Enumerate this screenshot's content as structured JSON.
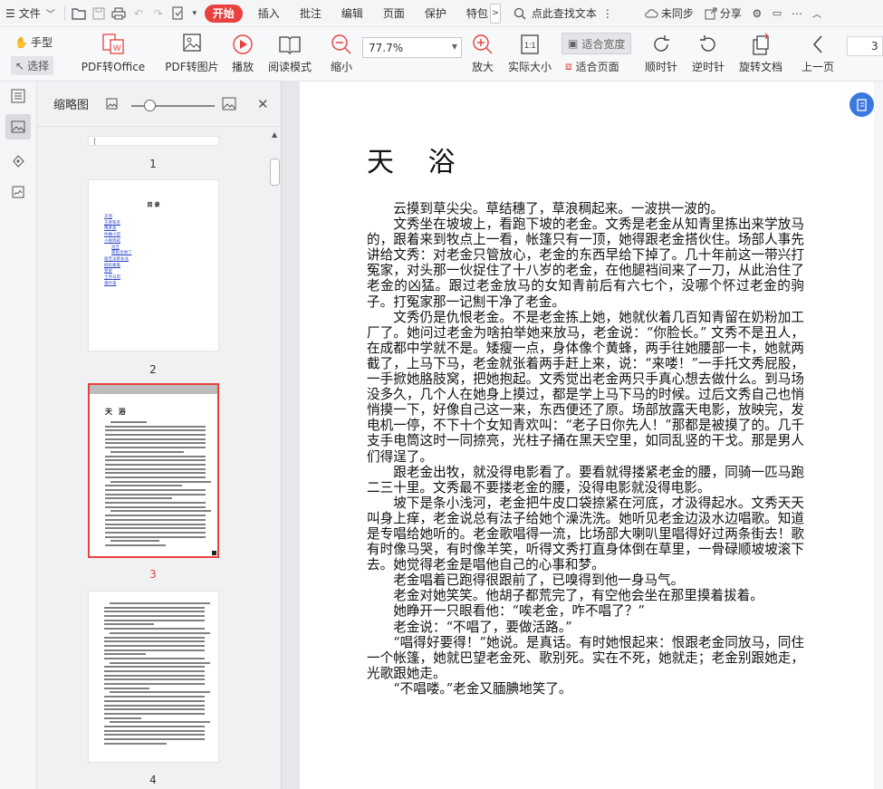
{
  "menubar": {
    "file_label": "文件",
    "tabs": [
      "开始",
      "插入",
      "批注",
      "编辑",
      "页面",
      "保护",
      "特包"
    ],
    "active_tab": "开始",
    "search_label": "点此查找文本",
    "sync_label": "未同步",
    "share_label": "分享"
  },
  "toolbar": {
    "hand_label": "手型",
    "select_label": "选择",
    "pdf_office_label": "PDF转Office",
    "pdf_image_label": "PDF转图片",
    "play_label": "播放",
    "read_mode_label": "阅读模式",
    "zoom_out_label": "缩小",
    "zoom_value": "77.7%",
    "zoom_in_label": "放大",
    "actual_size_label": "实际大小",
    "fit_width_label": "适合宽度",
    "fit_page_label": "适合页面",
    "rotate_cw_label": "顺时针",
    "rotate_ccw_label": "逆时针",
    "rotate_doc_label": "旋转文档",
    "prev_page_label": "上一页",
    "page_input": "3"
  },
  "thumbnail_panel": {
    "title": "缩略图",
    "pages": [
      {
        "num": "1"
      },
      {
        "num": "2",
        "heading": "目 录"
      },
      {
        "num": "3",
        "heading": "天 浴"
      },
      {
        "num": "4"
      }
    ],
    "selected_page": "3",
    "toc_lines": [
      "天浴",
      "王者和贪",
      "两茅盖",
      "你做小瓷",
      "小瓶戏班",
      "追旦",
      "孤鱼灵谢了",
      "极无法欲长龙",
      "奴妈素着",
      "星泉",
      "士月与剪",
      "落叶夜"
    ]
  },
  "document": {
    "title": "天  浴",
    "paragraphs": [
      "云摸到草尖尖。草结穗了，草浪稠起来。一波拱一波的。",
      "文秀坐在坡坡上，看跑下坡的老金。文秀是老金从知青里拣出来学放马的，跟着来到牧点上一看，帐篷只有一顶，她得跟老金搭伙住。场部人事先讲给文秀：对老金只管放心，老金的东西早给下掉了。几十年前这一带兴打冤家，对头那一伙捉住了十八岁的老金，在他腿裆间来了一刀，从此治住了老金的凶猛。跟过老金放马的女知青前后有六七个，没哪个怀过老金的驹子。打冤家那一记劁干净了老金。",
      "文秀仍是仇恨老金。不是老金拣上她，她就伙着几百知青留在奶粉加工厂了。她问过老金为啥拍举她来放马，老金说：“你脸长。” 文秀不是丑人，在成都中学就不是。矮瘦一点，身体像个黄蜂，两手往她腰部一卡，她就两截了，上马下马，老金就张着两手赶上来，说：“来喽！”一手托文秀屁股，一手掀她胳肢窝，把她抱起。文秀觉出老金两只手真心想去做什么。到马场没多久，几个人在她身上摸过，都是学上马下马的时候。过后文秀自己也悄悄摸一下，好像自己这一来，东西便还了原。场部放露天电影，放映完，发电机一停，不下十个女知青欢叫：“老子日你先人！”那都是被摸了的。几千支手电筒这时一同捺亮，光柱子捅在黑天空里，如同乱竖的干戈。那是男人们得逞了。",
      "跟老金出牧，就没得电影看了。要看就得搂紧老金的腰，同骑一匹马跑二三十里。文秀最不要搂老金的腰，没得电影就没得电影。",
      "坡下是条小浅河，老金把牛皮口袋捺紧在河底，才汲得起水。文秀天天叫身上痒，老金说总有法子给她个澡洗洗。她听见老金边汲水边唱歌。知道是专唱给她听的。老金歌唱得一流，比场部大喇叭里唱得好过两条街去！歌有时像马哭，有时像羊笑，听得文秀打直身体倒在草里，一骨碌顺坡坡滚下去。她觉得老金是唱他自己的心事和梦。",
      "老金唱着已跑得很跟前了，已嗅得到他一身马气。",
      "老金对她笑笑。他胡子都荒完了，有空他会坐在那里摸着拔着。",
      "她睁开一只眼看他：“唉老金，咋不唱了？”",
      "老金说：“不唱了，要做活路。”",
      "“唱得好要得！”她说。是真话。有时她恨起来：恨跟老金同放马，同住一个帐篷，她就巴望老金死、歌别死。实在不死，她就走；老金别跟她走，光歌跟她走。",
      "“不唱喽。”老金又腼腆地笑了。"
    ]
  },
  "colors": {
    "accent": "#e8413f",
    "float_button": "#3a78e0",
    "toolbar_bg": "#f7f8fa",
    "doc_bg": "#e6e7ea"
  }
}
